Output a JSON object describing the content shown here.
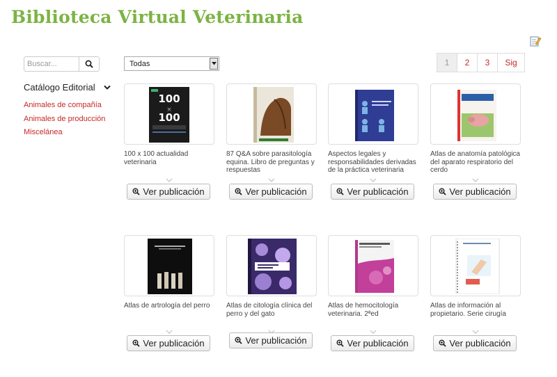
{
  "header": {
    "title": "Biblioteca Virtual Veterinaria"
  },
  "search": {
    "placeholder": "Buscar...",
    "icon": "search-icon"
  },
  "sidebar": {
    "catalog_label": "Catálogo Editorial",
    "categories": [
      {
        "label": "Animales de compañía"
      },
      {
        "label": "Animales de producción"
      },
      {
        "label": "Miscelánea"
      }
    ]
  },
  "filter": {
    "selected": "Todas"
  },
  "pagination": {
    "pages": [
      "1",
      "2",
      "3"
    ],
    "current": "1",
    "next_label": "Sig"
  },
  "colors": {
    "brand_green": "#7cb342",
    "link_red": "#c62828"
  },
  "button_label": "Ver publicación",
  "publications": [
    {
      "title": "100 x 100 actualidad veterinaria"
    },
    {
      "title": "87 Q&A sobre parasitología equina. Libro de preguntas y respuestas"
    },
    {
      "title": "Aspectos legales y responsabilidades derivadas de la práctica veterinaria"
    },
    {
      "title": "Atlas de anatomía patológica del aparato respiratorio del cerdo"
    },
    {
      "title": "Atlas de artrología del perro"
    },
    {
      "title": "Atlas de citología clínica del perro y del gato"
    },
    {
      "title": "Atlas de hemocitología veterinaria. 2ªed"
    },
    {
      "title": "Atlas de información al propietario. Serie cirugía"
    }
  ]
}
